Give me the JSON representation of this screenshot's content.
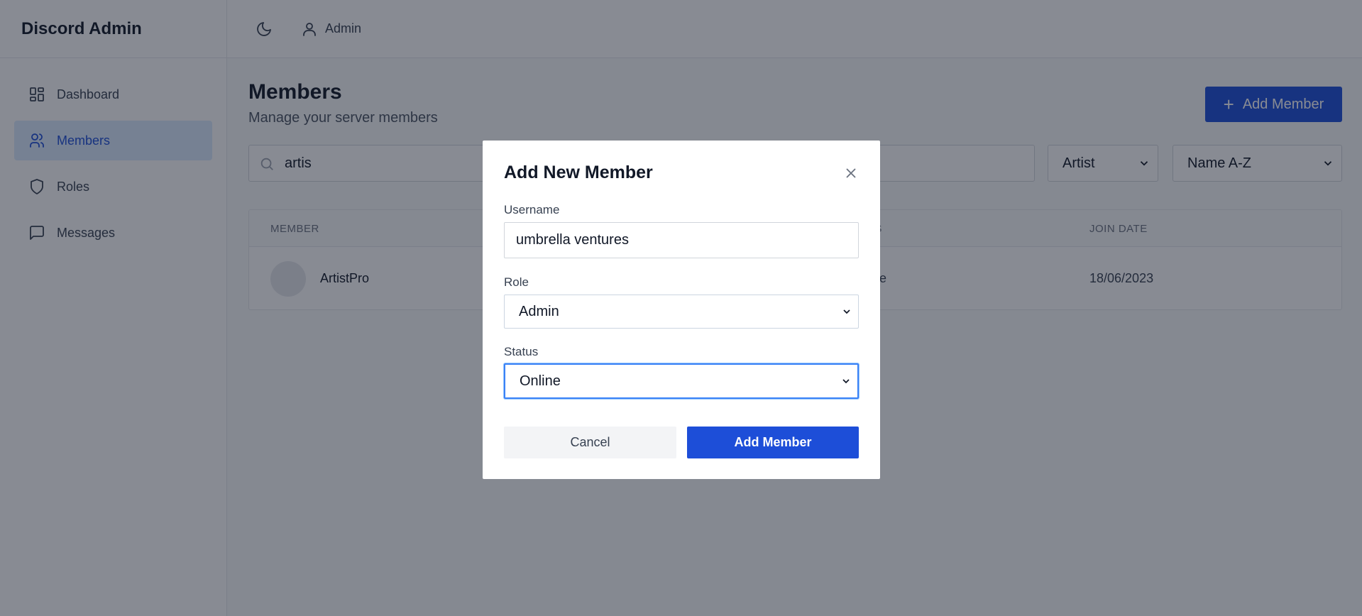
{
  "app": {
    "title": "Discord Admin"
  },
  "sidebar": {
    "items": [
      {
        "label": "Dashboard",
        "icon": "dashboard-icon"
      },
      {
        "label": "Members",
        "icon": "users-icon",
        "active": true
      },
      {
        "label": "Roles",
        "icon": "shield-icon"
      },
      {
        "label": "Messages",
        "icon": "message-icon"
      }
    ]
  },
  "header": {
    "theme_icon": "moon-icon",
    "user_label": "Admin"
  },
  "page": {
    "title": "Members",
    "subtitle": "Manage your server members",
    "add_button": "Add Member"
  },
  "filters": {
    "search_value": "artis",
    "role_filter": "Artist",
    "sort": "Name A-Z"
  },
  "table": {
    "columns": [
      "MEMBER",
      "STATUS",
      "JOIN DATE"
    ],
    "visible_headers": {
      "member": "MEMBER",
      "status_partial": "US",
      "join_date": "JOIN DATE"
    },
    "rows": [
      {
        "name": "ArtistPro",
        "status_partial": "line",
        "join_date": "18/06/2023"
      }
    ]
  },
  "modal": {
    "title": "Add New Member",
    "username_label": "Username",
    "username_value": "umbrella ventures",
    "role_label": "Role",
    "role_value": "Admin",
    "status_label": "Status",
    "status_value": "Online",
    "cancel": "Cancel",
    "submit": "Add Member"
  },
  "colors": {
    "accent": "#1d4ed8",
    "focus": "#3b82f6"
  }
}
